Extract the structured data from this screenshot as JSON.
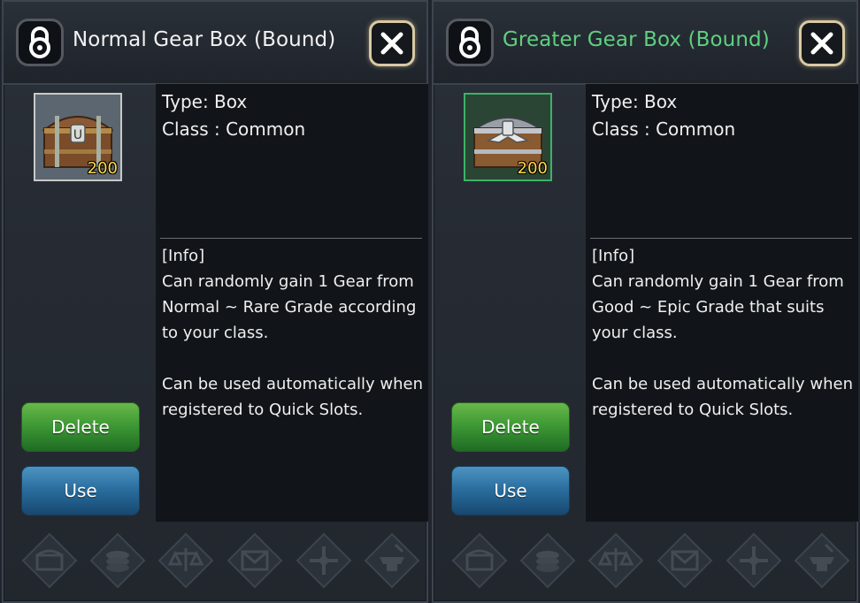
{
  "colors": {
    "title_normal": "#f2f2f2",
    "title_greater": "#5fd080",
    "quantity": "#ffd94a",
    "delete_button": "#3f9a35",
    "use_button": "#2b6fa0",
    "close_border": "#d8c9a2"
  },
  "panels": [
    {
      "title": "Normal Gear Box (Bound)",
      "lock_icon": "padlock-icon",
      "close_icon": "close-x-icon",
      "item": {
        "icon": "treasure-chest-icon",
        "quantity": "200",
        "frame": "white"
      },
      "type_line": "Type: Box",
      "class_line": "Class : Common",
      "info": "[Info]\nCan randomly gain 1 Gear from\nNormal ~ Rare Grade according\nto your class.\n\nCan be used automatically when\nregistered to Quick Slots.",
      "delete_label": "Delete",
      "use_label": "Use"
    },
    {
      "title": "Greater Gear Box (Bound)",
      "lock_icon": "padlock-icon",
      "close_icon": "close-x-icon",
      "item": {
        "icon": "winged-chest-icon",
        "quantity": "200",
        "frame": "green"
      },
      "type_line": "Type: Box",
      "class_line": "Class : Common",
      "info": "[Info]\nCan randomly gain 1 Gear from\nGood ~ Epic Grade that suits\nyour class.\n\nCan be used automatically when\nregistered to Quick Slots.",
      "delete_label": "Delete",
      "use_label": "Use"
    }
  ],
  "bottom_actions": [
    "storage-chest-icon",
    "coins-icon",
    "scale-icon",
    "mail-icon",
    "cross-arrows-icon",
    "anvil-icon"
  ]
}
